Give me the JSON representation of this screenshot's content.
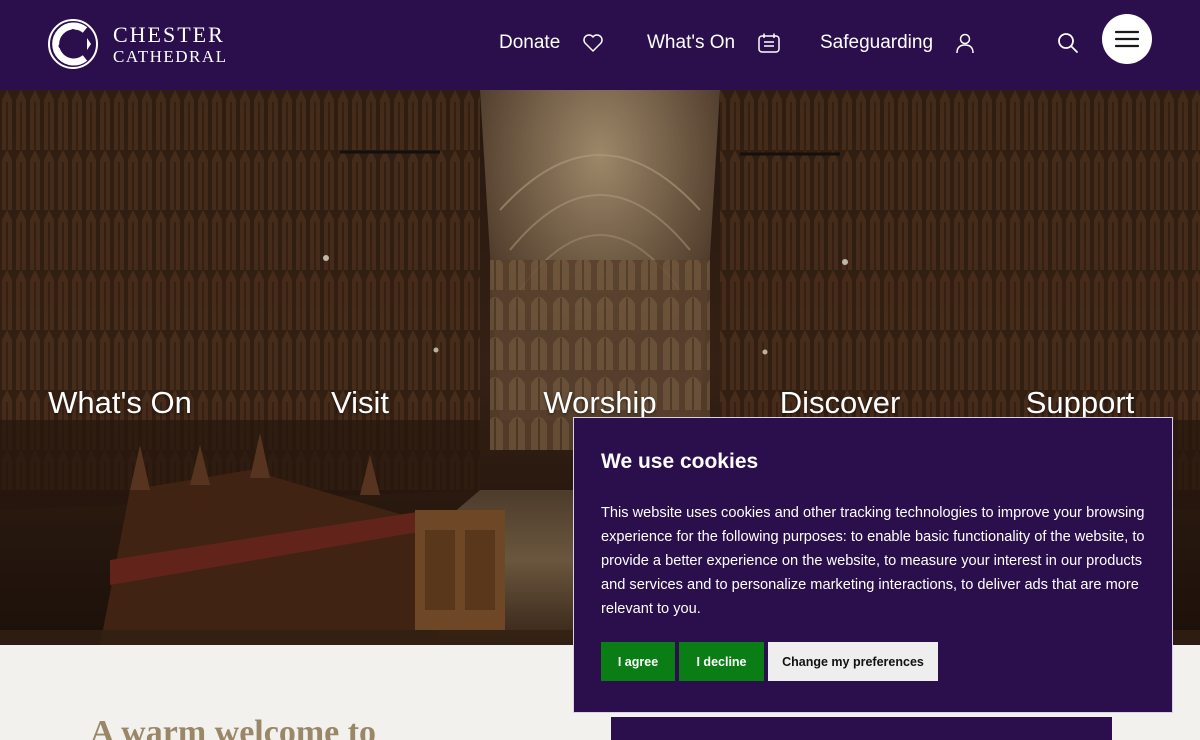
{
  "brand": {
    "line1": "CHESTER",
    "line2": "CATHEDRAL"
  },
  "header": {
    "nav": [
      {
        "label": "Donate",
        "icon": "heart-icon"
      },
      {
        "label": "What's On",
        "icon": "calendar-icon"
      },
      {
        "label": "Safeguarding",
        "icon": "user-icon"
      }
    ],
    "search_icon": "search-icon",
    "menu_icon": "hamburger-icon"
  },
  "hero": {
    "links": [
      "What's On",
      "Visit",
      "Worship",
      "Discover",
      "Support"
    ]
  },
  "main": {
    "welcome_heading": "A warm welcome to"
  },
  "cookie_banner": {
    "title": "We use cookies",
    "body": "This website uses cookies and other tracking technologies to improve your browsing experience for the following purposes: to enable basic functionality of the website, to provide a better experience on the website, to measure your interest in our products and services and to personalize marketing interactions, to deliver ads that are more relevant to you.",
    "agree_label": "I agree",
    "decline_label": "I decline",
    "preferences_label": "Change my preferences"
  },
  "colors": {
    "brand_purple": "#2b0f4c",
    "accept_green": "#0a7d14",
    "welcome_gold": "#9a8767"
  }
}
